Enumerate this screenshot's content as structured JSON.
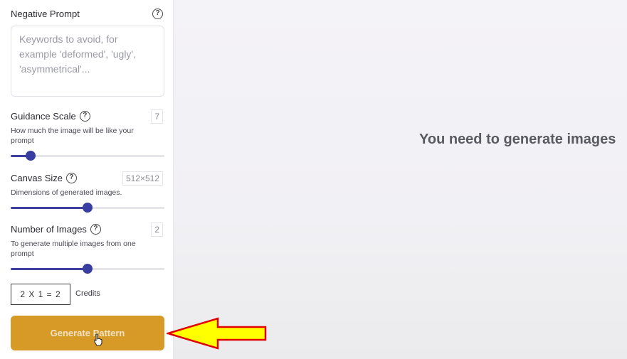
{
  "negative_prompt": {
    "label": "Negative Prompt",
    "placeholder": "Keywords to avoid, for example 'deformed', 'ugly', 'asymmetrical'..."
  },
  "guidance_scale": {
    "label": "Guidance Scale",
    "description": "How much the image will be like your prompt",
    "value": "7",
    "slider_fraction": 0.13
  },
  "canvas_size": {
    "label": "Canvas Size",
    "description": "Dimensions of generated images.",
    "value": "512×512",
    "slider_fraction": 0.5
  },
  "number_of_images": {
    "label": "Number of Images",
    "description": "To generate multiple images from one prompt",
    "value": "2",
    "slider_fraction": 0.5
  },
  "credits": {
    "formula": "2 X 1 = 2",
    "label": "Credits"
  },
  "generate_button": {
    "label": "Generate Pattern"
  },
  "main": {
    "message": "You need to generate images"
  },
  "colors": {
    "accent": "#3d3f9e",
    "button": "#d79a27",
    "arrow_fill": "#ffff00",
    "arrow_stroke": "#e10000"
  }
}
